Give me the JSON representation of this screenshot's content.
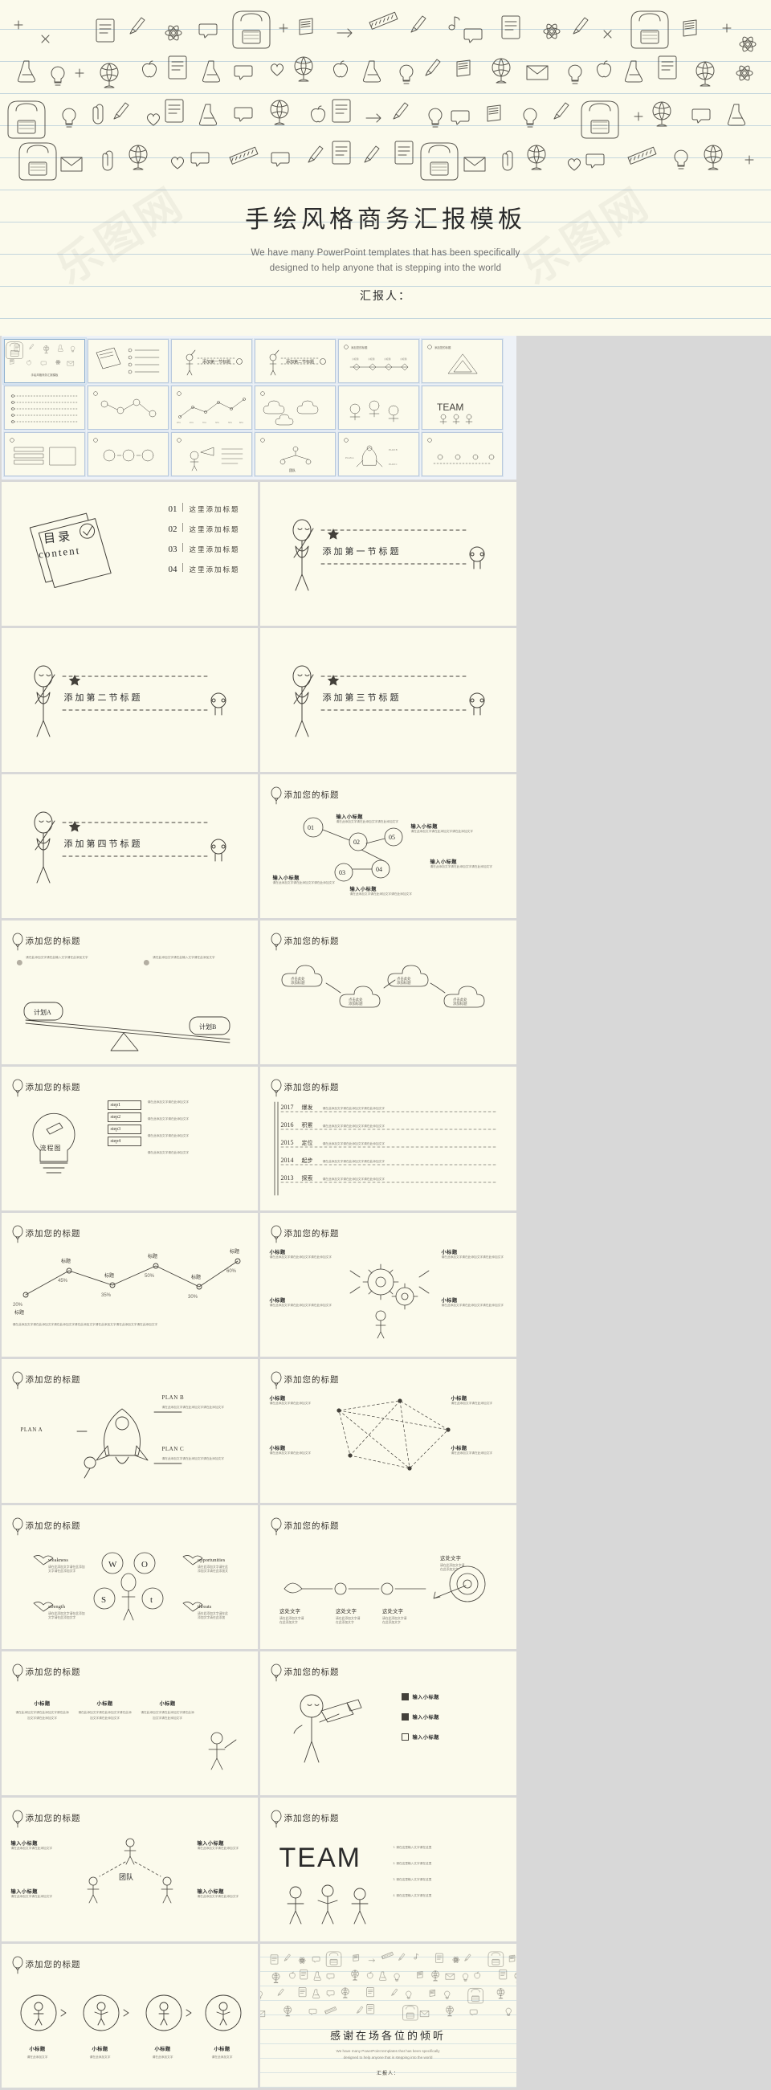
{
  "hero": {
    "title": "手绘风格商务汇报模板",
    "subtitle_line1": "We have many PowerPoint templates that has been specifically",
    "subtitle_line2": "designed to help anyone that is stepping into the world",
    "presenter": "汇报人："
  },
  "watermark": "乐图网",
  "catalog": {
    "badge_cn": "目录",
    "badge_en": "content",
    "items": [
      {
        "num": "01",
        "label": "这里添加标题"
      },
      {
        "num": "02",
        "label": "这里添加标题"
      },
      {
        "num": "03",
        "label": "这里添加标题"
      },
      {
        "num": "04",
        "label": "这里添加标题"
      }
    ]
  },
  "sections": [
    {
      "title": "添加第一节标题"
    },
    {
      "title": "添加第二节标题"
    },
    {
      "title": "添加第三节标题"
    },
    {
      "title": "添加第四节标题"
    }
  ],
  "common": {
    "slide_title": "添加您的标题",
    "sub_title": "小标题",
    "input_sub_title": "输入小标题",
    "body_text": "请在此添加文字请在此添加文字请在此添加文字",
    "body_short": "请在此添加文字",
    "placeholder_text": "这里添加文字"
  },
  "slides": {
    "node_chart": {
      "title": "添加您的标题",
      "nodes": [
        "01",
        "02",
        "03",
        "04",
        "05"
      ],
      "labels": [
        "输入小标题",
        "输入小标题",
        "输入小标题",
        "输入小标题",
        "输入小标题"
      ],
      "body": "请在此添加文字请在此添加文字请在此添加文字"
    },
    "seesaw": {
      "title": "添加您的标题",
      "left_label": "计划A",
      "right_label": "计划B",
      "body": "请在此添加文字请在此输入文字请在此添加文字"
    },
    "clouds": {
      "title": "添加您的标题",
      "items": [
        "点击此处添加标题",
        "点击此处添加标题",
        "点击此处添加标题",
        "点击此处添加标题"
      ]
    },
    "flow": {
      "title": "添加您的标题",
      "bulb_label": "流程图",
      "steps": [
        "step1",
        "step2",
        "step3",
        "step4"
      ],
      "step_texts": [
        "请在此添加文字请在此添加文字",
        "请在此添加文字请在此添加文字",
        "请在此添加文字请在此添加文字",
        "请在此添加文字请在此添加文字"
      ]
    },
    "timeline_years": {
      "title": "添加您的标题",
      "rows": [
        {
          "year": "2017",
          "label": "爆发",
          "text": "请在此添加文字请在此添加文字请在此添加文字"
        },
        {
          "year": "2016",
          "label": "积累",
          "text": "请在此添加文字请在此添加文字请在此添加文字"
        },
        {
          "year": "2015",
          "label": "定位",
          "text": "请在此添加文字请在此添加文字请在此添加文字"
        },
        {
          "year": "2014",
          "label": "起步",
          "text": "请在此添加文字请在此添加文字请在此添加文字"
        },
        {
          "year": "2013",
          "label": "探索",
          "text": "请在此添加文字请在此添加文字请在此添加文字"
        }
      ]
    },
    "line_chart": {
      "title": "添加您的标题",
      "values": [
        "20%",
        "45%",
        "35%",
        "50%",
        "30%",
        "60%"
      ],
      "point_labels": [
        "标题",
        "标题",
        "标题",
        "标题",
        "标题",
        "标题"
      ],
      "body": "请在此添加文字请在此添加文字请在此添加文字请在此添加文字请在此添加文字请在此添加文字请在此添加文字"
    },
    "gears": {
      "title": "添加您的标题",
      "headings": [
        "小标题",
        "小标题",
        "小标题",
        "小标题"
      ],
      "body": "请在此添加文字请在此添加文字请在此添加文字"
    },
    "rocket": {
      "title": "添加您的标题",
      "plans": [
        "PLAN A",
        "PLAN B",
        "PLAN C"
      ],
      "body": "请在此添加文字请在此添加文字请在此添加文字"
    },
    "network": {
      "title": "添加您的标题",
      "headings": [
        "小标题",
        "小标题",
        "小标题",
        "小标题"
      ],
      "body": "请在此添加文字请在此添加文字"
    },
    "swot": {
      "title": "添加您的标题",
      "letters": [
        "W",
        "O",
        "S",
        "t"
      ],
      "labels": [
        "weakness",
        "opportunities",
        "strength",
        "threats"
      ],
      "body": "请在此添加文字请在此添加文字"
    },
    "arrow_target": {
      "title": "添加您的标题",
      "labels": [
        "这里文字",
        "这里文字",
        "这里文字"
      ],
      "body": "请在此添加文字请在此添加文字"
    },
    "four_col": {
      "title": "添加您的标题",
      "headings": [
        "小标题",
        "小标题",
        "小标题"
      ],
      "body": "请在此添加文字请在此添加文字请在此添加文字请在此添加文字"
    },
    "telescope": {
      "title": "添加您的标题",
      "items": [
        "输入小标题",
        "输入小标题",
        "输入小标题"
      ],
      "body": "请在此添加文字请在此添加文字"
    },
    "team": {
      "title": "添加您的标题",
      "center_label": "团队",
      "items": [
        "输入小标题",
        "输入小标题",
        "输入小标题",
        "输入小标题"
      ],
      "body": "请在此添加文字请在此添加文字"
    },
    "team_word": {
      "title": "添加您的标题",
      "word": "TEAM",
      "bullets": [
        "1. 请在这里输入文字请在这里",
        "2. 请在这里输入文字请在这里",
        "3. 请在这里输入文字请在这里",
        "4. 请在这里输入文字请在这里"
      ]
    },
    "process4": {
      "title": "添加您的标题",
      "headings": [
        "小标题",
        "小标题",
        "小标题",
        "小标题"
      ],
      "body": "请在此添加文字\n请在此添加文字\n请在此添加文字\n请在此添加文字"
    },
    "thanks": {
      "title": "感谢在场各位的倾听",
      "subtitle_line1": "We have many PowerPoint templates that has been specifically",
      "subtitle_line2": "designed to help anyone that is stepping into the world",
      "presenter": "汇报人："
    }
  },
  "colors": {
    "paper": "#fbfaec",
    "ink": "#43403a",
    "rule": "#78a5c8",
    "frame": "#d8d8d8"
  }
}
